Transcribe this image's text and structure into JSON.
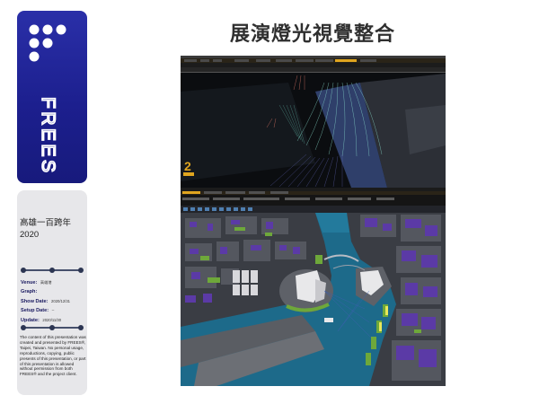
{
  "brand": {
    "name": "FREES"
  },
  "event": {
    "title": "高雄一百跨年",
    "year": "2020"
  },
  "info": {
    "venue_label": "Venue:",
    "venue_value": "高雄港",
    "graph_label": "Graph:",
    "graph_value": "",
    "show_date_label": "Show Date:",
    "show_date_value": "2020/12/31",
    "setup_date_label": "Setup Date:",
    "setup_date_value": "--",
    "update_label": "Update:",
    "update_value": "2020/11/30"
  },
  "disclaimer": "The content of this presentation was created and presented by FREES®, Taipei, Taiwan. No personal usage, reproductions, copying, public presents of this presentation, or part of this presentation is allowed without permission from both FREES® and the project client.",
  "page": {
    "title": "展演燈光視覺整合"
  },
  "colors": {
    "brand_blue": "#1c1f8e",
    "panel_gray": "#e7e7ea",
    "divider": "#2c3552",
    "water": "#1d6a8a",
    "building_purple": "#5b3aa6",
    "park_green": "#6ea83a"
  },
  "icons": {
    "logo_mark": "dot-grid-logo-icon"
  }
}
